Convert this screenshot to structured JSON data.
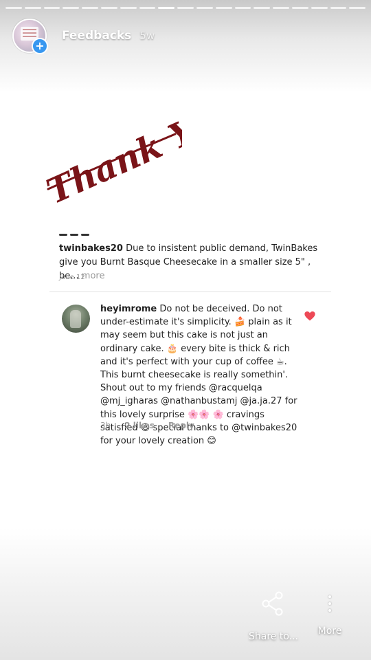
{
  "story": {
    "progress_segments": 19,
    "active_segment_index": 8,
    "account_name": "Feedbacks",
    "posted_ago": "5w"
  },
  "image": {
    "headline": "Thank You!",
    "post": {
      "username": "twinbakes20",
      "caption": "Due to insistent public demand, TwinBakes give you Burnt Basque Cheesecake in a smaller size 5\" , be...",
      "more_label": "more",
      "date": "June 12"
    },
    "comment": {
      "username": "heyimrome",
      "text": "Do not be deceived. Do not under-estimate it's simplicity. 🍰 plain as it may seem but this cake is not just an ordinary cake. 🎂 every bite is thick & rich and it's perfect with your cup of coffee ☕. This burnt cheesecake is really somethin'. Shout out to my friends @racquelqa @mj_igharas @nathanbustamj @ja.ja.27  for this lovely surprise 🌸🌸 🌸 cravings satisfied 😆 special thanks to @twinbakes20 for your lovely creation 😊",
      "time": "3h",
      "likes": "2 likes",
      "reply_label": "Reply"
    }
  },
  "actions": {
    "share_label": "Share to...",
    "more_label": "More"
  },
  "colors": {
    "thank_you": "#7a1418",
    "heart": "#ed4956",
    "badge": "#3897f0"
  }
}
